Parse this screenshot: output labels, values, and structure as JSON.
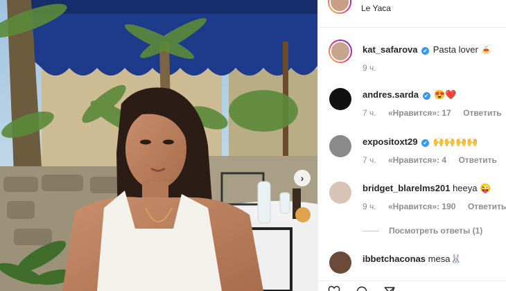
{
  "post": {
    "location": "Le Yaca"
  },
  "caption": {
    "username": "kat_safarova",
    "text": "Pasta lover 🍝",
    "time": "9 ч."
  },
  "comments": [
    {
      "username": "andres.sarda",
      "verified": true,
      "text": "😍❤️",
      "time": "7 ч.",
      "likes": "«Нравится»: 17",
      "reply": "Ответить"
    },
    {
      "username": "expositoxt29",
      "verified": true,
      "text": "🙌🙌🙌🙌",
      "time": "7 ч.",
      "likes": "«Нравится»: 4",
      "reply": "Ответить"
    },
    {
      "username": "bridget_blarelms201",
      "verified": false,
      "text": "heeya 😜",
      "time": "9 ч.",
      "likes": "«Нравится»: 190",
      "reply": "Ответить"
    },
    {
      "username": "ibbetchaconas",
      "verified": false,
      "text": "mesa🐰"
    }
  ],
  "view_replies": "Посмотреть ответы (1)",
  "icons": {
    "verified": "✔",
    "carousel_next": "›"
  }
}
